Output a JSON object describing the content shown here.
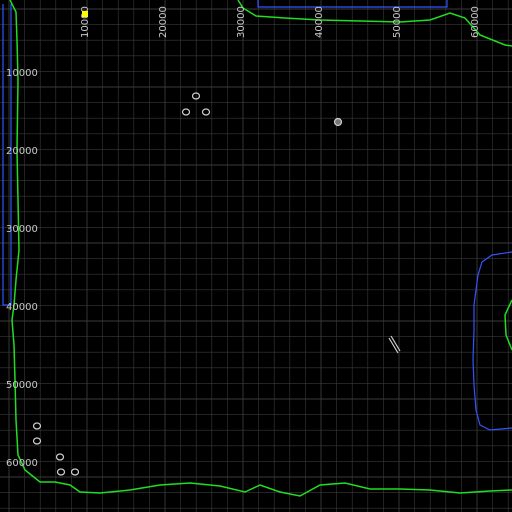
{
  "viewer": {
    "background": "#000000",
    "grid_color": "#3a3a3a",
    "label_color": "#c8c8c8",
    "outline_color": "#22dd22",
    "boundary_color": "#3355ff",
    "marker_color": "#ffff00",
    "object_color": "#cfcfcf"
  },
  "axes": {
    "x_ticks": [
      "10000",
      "20000",
      "30000",
      "40000",
      "50000",
      "60000"
    ],
    "y_ticks": [
      "10000",
      "20000",
      "30000",
      "40000",
      "50000",
      "60000"
    ]
  }
}
